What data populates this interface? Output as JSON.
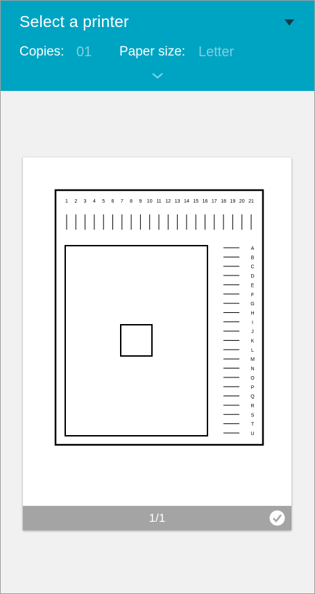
{
  "header": {
    "title": "Select a printer",
    "copies_label": "Copies:",
    "copies_value": "01",
    "paper_size_label": "Paper size:",
    "paper_size_value": "Letter"
  },
  "preview": {
    "column_numbers": [
      "1",
      "2",
      "3",
      "4",
      "5",
      "6",
      "7",
      "8",
      "9",
      "10",
      "11",
      "12",
      "13",
      "14",
      "15",
      "16",
      "17",
      "18",
      "19",
      "20",
      "21"
    ],
    "row_letters": [
      "A",
      "B",
      "C",
      "D",
      "E",
      "F",
      "G",
      "H",
      "I",
      "J",
      "K",
      "L",
      "M",
      "N",
      "O",
      "P",
      "Q",
      "R",
      "S",
      "T",
      "U"
    ],
    "page_indicator": "1/1"
  },
  "colors": {
    "accent": "#00a4c3",
    "background": "#f1f1f1",
    "footer_bar": "#a4a4a4"
  },
  "icons": {
    "dropdown": "triangle-down-icon",
    "expand": "chevron-down-icon",
    "selected": "check-circle-icon"
  }
}
